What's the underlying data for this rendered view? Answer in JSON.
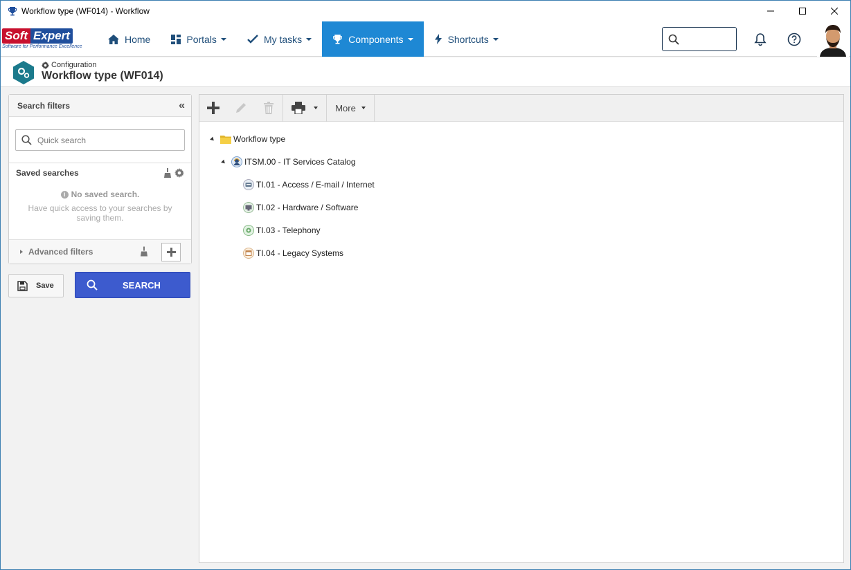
{
  "window": {
    "title": "Workflow type (WF014) - Workflow"
  },
  "logo": {
    "brand_soft": "Soft",
    "brand_expert": "Expert",
    "tagline": "Software for Performance Excellence"
  },
  "nav": {
    "items": [
      {
        "label": "Home",
        "icon": "home-icon",
        "has_caret": false,
        "active": false
      },
      {
        "label": "Portals",
        "icon": "portals-icon",
        "has_caret": true,
        "active": false
      },
      {
        "label": "My tasks",
        "icon": "check-icon",
        "has_caret": true,
        "active": false
      },
      {
        "label": "Components",
        "icon": "trophy-icon",
        "has_caret": true,
        "active": true
      },
      {
        "label": "Shortcuts",
        "icon": "bolt-icon",
        "has_caret": true,
        "active": false
      }
    ],
    "search_placeholder": ""
  },
  "header": {
    "breadcrumb": "Configuration",
    "title": "Workflow type (WF014)"
  },
  "filters": {
    "title": "Search filters",
    "quick_search_placeholder": "Quick search",
    "saved_title": "Saved searches",
    "no_saved": "No saved search.",
    "hint": "Have quick access to your searches by saving them.",
    "advanced": "Advanced filters",
    "save_label": "Save",
    "search_label": "SEARCH"
  },
  "toolbar": {
    "more_label": "More"
  },
  "tree": {
    "root": {
      "label": "Workflow type",
      "icon": "folder-icon"
    },
    "group": {
      "label": "ITSM.00 - IT Services Catalog",
      "icon": "support-agent-icon"
    },
    "children": [
      {
        "label": "TI.01 - Access / E-mail / Internet",
        "icon": "access-icon"
      },
      {
        "label": "TI.02 - Hardware / Software",
        "icon": "monitor-icon"
      },
      {
        "label": "TI.03 - Telephony",
        "icon": "telephony-icon"
      },
      {
        "label": "TI.04 - Legacy Systems",
        "icon": "legacy-icon"
      }
    ]
  },
  "colors": {
    "nav_active": "#1e88d4",
    "nav_text": "#1f4e7a",
    "search_button": "#3d5bce",
    "logo_red": "#c8102e",
    "logo_blue": "#1f4e9c"
  }
}
